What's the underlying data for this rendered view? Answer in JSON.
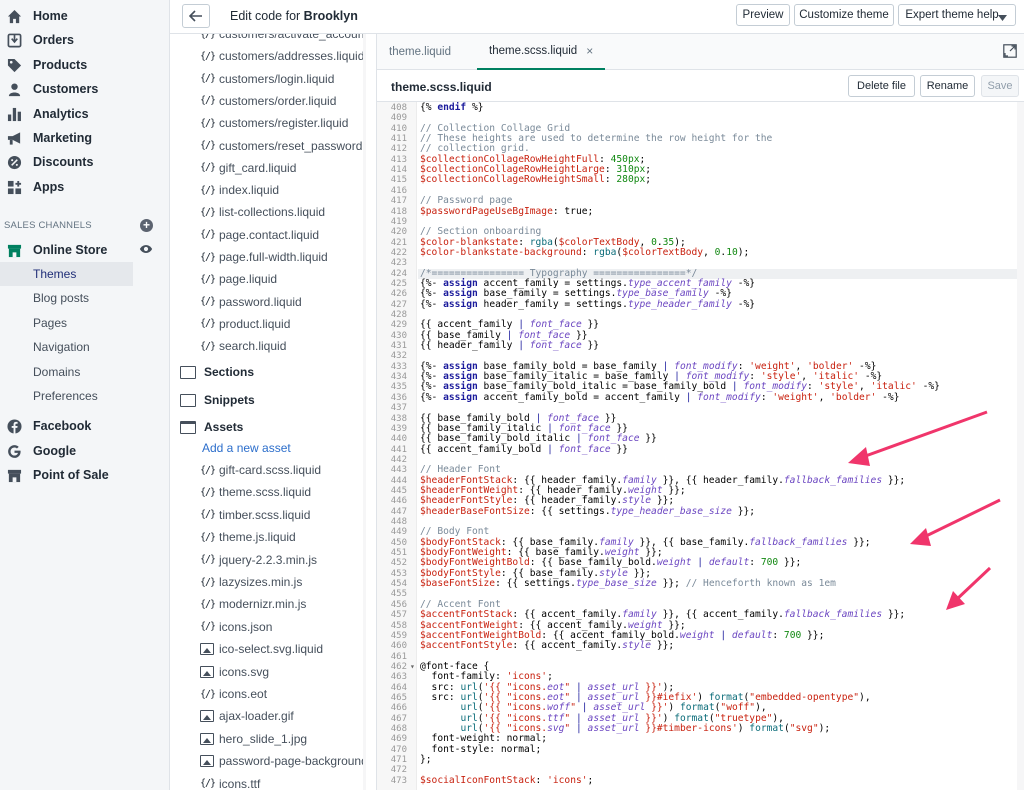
{
  "nav": {
    "main": [
      {
        "label": "Home",
        "icon": "home-icon"
      },
      {
        "label": "Orders",
        "icon": "orders-icon"
      },
      {
        "label": "Products",
        "icon": "tag-icon"
      },
      {
        "label": "Customers",
        "icon": "person-icon"
      },
      {
        "label": "Analytics",
        "icon": "bar-chart-icon"
      },
      {
        "label": "Marketing",
        "icon": "megaphone-icon"
      },
      {
        "label": "Discounts",
        "icon": "discount-icon"
      },
      {
        "label": "Apps",
        "icon": "apps-icon"
      }
    ],
    "sales_channels_heading": "SALES CHANNELS",
    "online_store": "Online Store",
    "online_store_sub": [
      "Themes",
      "Blog posts",
      "Pages",
      "Navigation",
      "Domains",
      "Preferences"
    ],
    "other_channels": [
      {
        "label": "Facebook",
        "icon": "facebook-icon"
      },
      {
        "label": "Google",
        "icon": "google-icon"
      },
      {
        "label": "Point of Sale",
        "icon": "store-icon"
      }
    ]
  },
  "topbar": {
    "title_prefix": "Edit code for",
    "theme_name": "Brooklyn",
    "preview": "Preview",
    "customize": "Customize theme",
    "expert": "Expert theme help"
  },
  "files": {
    "templates": [
      "customers/activate_account.liquid",
      "customers/addresses.liquid",
      "customers/login.liquid",
      "customers/order.liquid",
      "customers/register.liquid",
      "customers/reset_password.liquid",
      "gift_card.liquid",
      "index.liquid",
      "list-collections.liquid",
      "page.contact.liquid",
      "page.full-width.liquid",
      "page.liquid",
      "password.liquid",
      "product.liquid",
      "search.liquid"
    ],
    "sections_label": "Sections",
    "snippets_label": "Snippets",
    "assets_label": "Assets",
    "add_asset": "Add a new asset",
    "assets": [
      {
        "name": "gift-card.scss.liquid",
        "kind": "code"
      },
      {
        "name": "theme.scss.liquid",
        "kind": "code"
      },
      {
        "name": "timber.scss.liquid",
        "kind": "code"
      },
      {
        "name": "theme.js.liquid",
        "kind": "code"
      },
      {
        "name": "jquery-2.2.3.min.js",
        "kind": "code"
      },
      {
        "name": "lazysizes.min.js",
        "kind": "code"
      },
      {
        "name": "modernizr.min.js",
        "kind": "code"
      },
      {
        "name": "icons.json",
        "kind": "code"
      },
      {
        "name": "ico-select.svg.liquid",
        "kind": "image"
      },
      {
        "name": "icons.svg",
        "kind": "image"
      },
      {
        "name": "icons.eot",
        "kind": "code"
      },
      {
        "name": "ajax-loader.gif",
        "kind": "image"
      },
      {
        "name": "hero_slide_1.jpg",
        "kind": "image"
      },
      {
        "name": "password-page-background",
        "kind": "image"
      },
      {
        "name": "icons.ttf",
        "kind": "code"
      }
    ],
    "file_icon_glyph": "{/}"
  },
  "editor": {
    "tabs": [
      "theme.liquid",
      "theme.scss.liquid"
    ],
    "close_glyph": "×",
    "file_name": "theme.scss.liquid",
    "delete": "Delete file",
    "rename": "Rename",
    "save": "Save",
    "line_numbers_start": 408,
    "code_lines": [
      "{% endif %}",
      "",
      "// Collection Collage Grid",
      "// These heights are used to determine the row height for the",
      "// collection grid.",
      "$collectionCollageRowHeightFull: 450px;",
      "$collectionCollageRowHeightLarge: 310px;",
      "$collectionCollageRowHeightSmall: 280px;",
      "",
      "// Password page",
      "$passwordPageUseBgImage: true;",
      "",
      "// Section onboarding",
      "$color-blankstate: rgba($colorTextBody, 0.35);",
      "$color-blankstate-background: rgba($colorTextBody, 0.10);",
      "",
      "/*================ Typography ================*/",
      "{%- assign accent_family = settings.type_accent_family -%}",
      "{%- assign base_family = settings.type_base_family -%}",
      "{%- assign header_family = settings.type_header_family -%}",
      "",
      "{{ accent_family | font_face }}",
      "{{ base_family | font_face }}",
      "{{ header_family | font_face }}",
      "",
      "{%- assign base_family_bold = base_family | font_modify: 'weight', 'bolder' -%}",
      "{%- assign base_family_italic = base_family | font_modify: 'style', 'italic' -%}",
      "{%- assign base_family_bold_italic = base_family_bold | font_modify: 'style', 'italic' -%}",
      "{%- assign accent_family_bold = accent_family | font_modify: 'weight', 'bolder' -%}",
      "",
      "{{ base_family_bold | font_face }}",
      "{{ base_family_italic | font_face }}",
      "{{ base_family_bold_italic | font_face }}",
      "{{ accent_family_bold | font_face }}",
      "",
      "// Header Font",
      "$headerFontStack: {{ header_family.family }}, {{ header_family.fallback_families }};",
      "$headerFontWeight: {{ header_family.weight }};",
      "$headerFontStyle: {{ header_family.style }};",
      "$headerBaseFontSize: {{ settings.type_header_base_size }};",
      "",
      "// Body Font",
      "$bodyFontStack: {{ base_family.family }}, {{ base_family.fallback_families }};",
      "$bodyFontWeight: {{ base_family.weight }};",
      "$bodyFontWeightBold: {{ base_family_bold.weight | default: 700 }};",
      "$bodyFontStyle: {{ base_family.style }};",
      "$baseFontSize: {{ settings.type_base_size }}; // Henceforth known as 1em",
      "",
      "// Accent Font",
      "$accentFontStack: {{ accent_family.family }}, {{ accent_family.fallback_families }};",
      "$accentFontWeight: {{ accent_family.weight }};",
      "$accentFontWeightBold: {{ accent_family_bold.weight | default: 700 }};",
      "$accentFontStyle: {{ accent_family.style }};",
      "",
      "@font-face {",
      "  font-family: 'icons';",
      "  src: url('{{ \"icons.eot\" | asset_url }}');",
      "  src: url('{{ \"icons.eot\" | asset_url }}#iefix') format(\"embedded-opentype\"),",
      "       url('{{ \"icons.woff\" | asset_url }}') format(\"woff\"),",
      "       url('{{ \"icons.ttf\" | asset_url }}') format(\"truetype\"),",
      "       url('{{ \"icons.svg\" | asset_url }}#timber-icons') format(\"svg\");",
      "  font-weight: normal;",
      "  font-style: normal;",
      "};",
      "",
      "$socialIconFontStack: 'icons';"
    ]
  },
  "colors": {
    "accent_tab": "#008060",
    "annotation_arrow": "#f0356b",
    "link": "#2c6ecb"
  }
}
